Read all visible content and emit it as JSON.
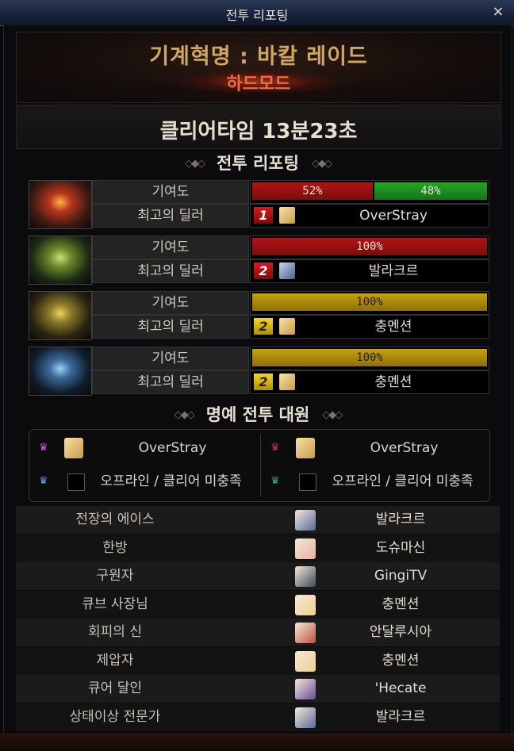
{
  "window": {
    "title": "전투 리포팅",
    "close": "×"
  },
  "header": {
    "raid_name": "기계혁명 : 바칼 레이드",
    "mode": "하드모드"
  },
  "clear_time": "클리어타임 13분23초",
  "sections": {
    "battle_report": "전투 리포팅",
    "honor": "명예 전투 대원"
  },
  "ornament": "◇◆◇",
  "labels": {
    "contribution": "기여도",
    "top_dealer": "최고의 딜러"
  },
  "bosses": [
    {
      "bars": [
        {
          "value": 52,
          "label": "52%",
          "color": "red"
        },
        {
          "value": 48,
          "label": "48%",
          "color": "green"
        }
      ],
      "rank": "1",
      "dealer": "OverStray",
      "theme": "fire"
    },
    {
      "bars": [
        {
          "value": 100,
          "label": "100%",
          "color": "red"
        }
      ],
      "rank": "2",
      "dealer": "발라크르",
      "theme": "green"
    },
    {
      "bars": [
        {
          "value": 100,
          "label": "100%",
          "color": "gold"
        }
      ],
      "rank": "2",
      "dealer": "충멘션",
      "theme": "gold"
    },
    {
      "bars": [
        {
          "value": 100,
          "label": "100%",
          "color": "gold"
        }
      ],
      "rank": "2",
      "dealer": "충멘션",
      "theme": "ice"
    }
  ],
  "honor": [
    {
      "name": "OverStray",
      "present": true,
      "crown_color": "#d25ad8"
    },
    {
      "name": "OverStray",
      "present": true,
      "crown_color": "#c0403c"
    },
    {
      "name": "오프라인 / 클리어 미충족",
      "present": false,
      "crown_color": "#6aa0e0"
    },
    {
      "name": "오프라인 / 클리어 미충족",
      "present": false,
      "crown_color": "#3fb06a"
    }
  ],
  "awards": [
    {
      "title": "전장의 에이스",
      "player": "발라크르"
    },
    {
      "title": "한방",
      "player": "도슈마신"
    },
    {
      "title": "구원자",
      "player": "GingiTV"
    },
    {
      "title": "큐브 사장님",
      "player": "충멘션"
    },
    {
      "title": "회피의 신",
      "player": "안달루시아"
    },
    {
      "title": "제압자",
      "player": "충멘션"
    },
    {
      "title": "큐어 달인",
      "player": "'Hecate"
    },
    {
      "title": "상태이상 전문가",
      "player": "발라크르"
    }
  ],
  "colors": {
    "accent_gold": "#d1a760",
    "mode_red": "#f36a42",
    "bar_red": "#b01414",
    "bar_green": "#26a526",
    "bar_gold": "#c7a10f"
  }
}
